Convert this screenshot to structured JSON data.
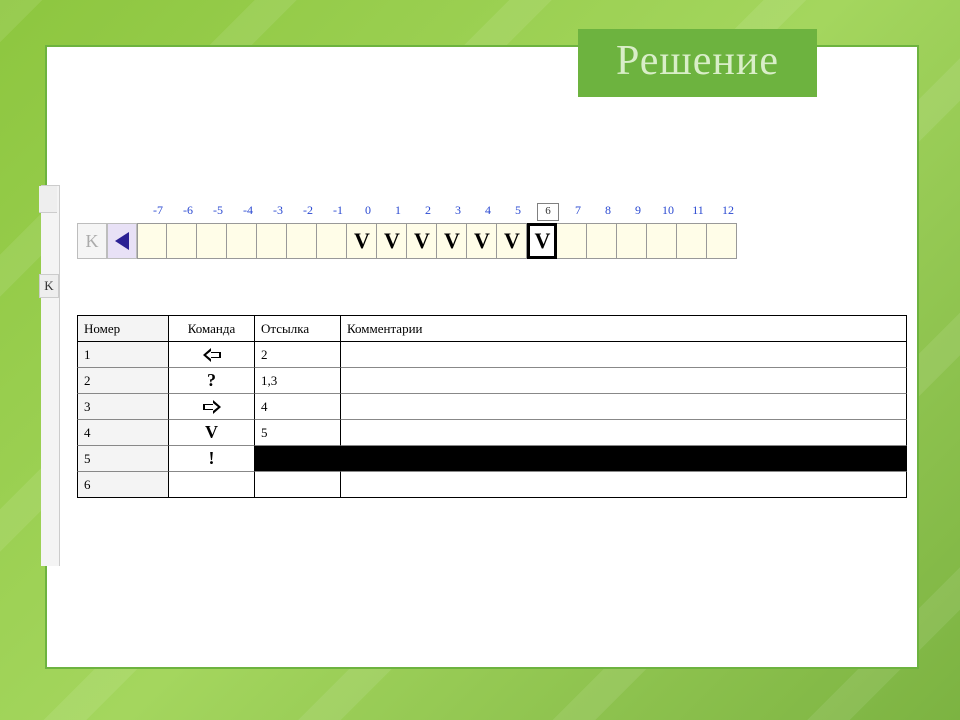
{
  "title": "Решение",
  "gutter": {
    "kLabel": "K"
  },
  "tape": {
    "buttons": {
      "k_label": "K"
    },
    "ticks": [
      "-7",
      "-6",
      "-5",
      "-4",
      "-3",
      "-2",
      "-1",
      "0",
      "1",
      "2",
      "3",
      "4",
      "5",
      "6",
      "7",
      "8",
      "9",
      "10",
      "11",
      "12"
    ],
    "head_index": 13,
    "cells": [
      {
        "v": ""
      },
      {
        "v": ""
      },
      {
        "v": ""
      },
      {
        "v": ""
      },
      {
        "v": ""
      },
      {
        "v": ""
      },
      {
        "v": ""
      },
      {
        "v": "V"
      },
      {
        "v": "V"
      },
      {
        "v": "V"
      },
      {
        "v": "V"
      },
      {
        "v": "V"
      },
      {
        "v": "V"
      },
      {
        "v": "V"
      },
      {
        "v": ""
      },
      {
        "v": ""
      },
      {
        "v": ""
      },
      {
        "v": ""
      },
      {
        "v": ""
      },
      {
        "v": ""
      }
    ]
  },
  "table": {
    "headers": {
      "num": "Номер",
      "cmd": "Команда",
      "ref": "Отсылка",
      "comment": "Комментарии"
    },
    "rows": [
      {
        "num": "1",
        "cmd": "arrow-left",
        "ref": "2",
        "comment": "",
        "hl": false
      },
      {
        "num": "2",
        "cmd": "?",
        "ref": "1,3",
        "comment": "",
        "hl": false
      },
      {
        "num": "3",
        "cmd": "arrow-right",
        "ref": "4",
        "comment": "",
        "hl": false
      },
      {
        "num": "4",
        "cmd": "V",
        "ref": "5",
        "comment": "",
        "hl": false
      },
      {
        "num": "5",
        "cmd": "!",
        "ref": "",
        "comment": "",
        "hl": true
      },
      {
        "num": "6",
        "cmd": "",
        "ref": "",
        "comment": "",
        "hl": false
      }
    ]
  }
}
